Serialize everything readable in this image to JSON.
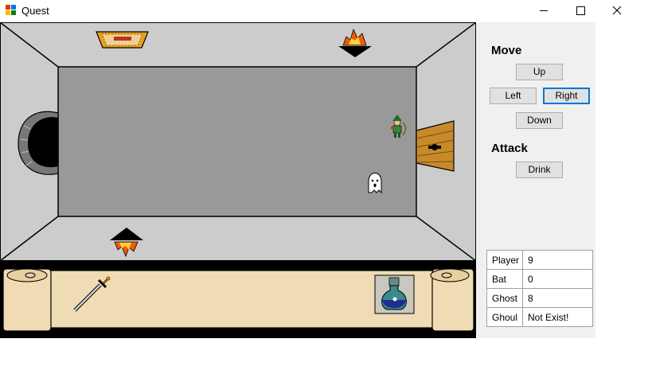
{
  "window": {
    "title": "Quest",
    "controls": [
      "minimize-icon",
      "maximize-icon",
      "close-icon"
    ]
  },
  "panel": {
    "move_label": "Move",
    "attack_label": "Attack",
    "buttons": {
      "up": "Up",
      "left": "Left",
      "right": "Right",
      "down": "Down",
      "drink": "Drink"
    },
    "focused_button": "right"
  },
  "stats": [
    {
      "name": "Player",
      "value": "9"
    },
    {
      "name": "Bat",
      "value": "0"
    },
    {
      "name": "Ghost",
      "value": "8"
    },
    {
      "name": "Ghoul",
      "value": "Not Exist!"
    }
  ],
  "scene": {
    "sprites": [
      "player-icon",
      "ghost-icon",
      "torch-icon",
      "door-icon",
      "archway-icon",
      "trapdoor-icon"
    ],
    "inventory": [
      "sword-icon",
      "blue-potion-icon"
    ],
    "selected_item": "blue-potion-icon"
  },
  "colors": {
    "floor": "#999999",
    "wall": "#cccccc",
    "scroll": "#f0dcb4",
    "focus": "#0078d7"
  }
}
